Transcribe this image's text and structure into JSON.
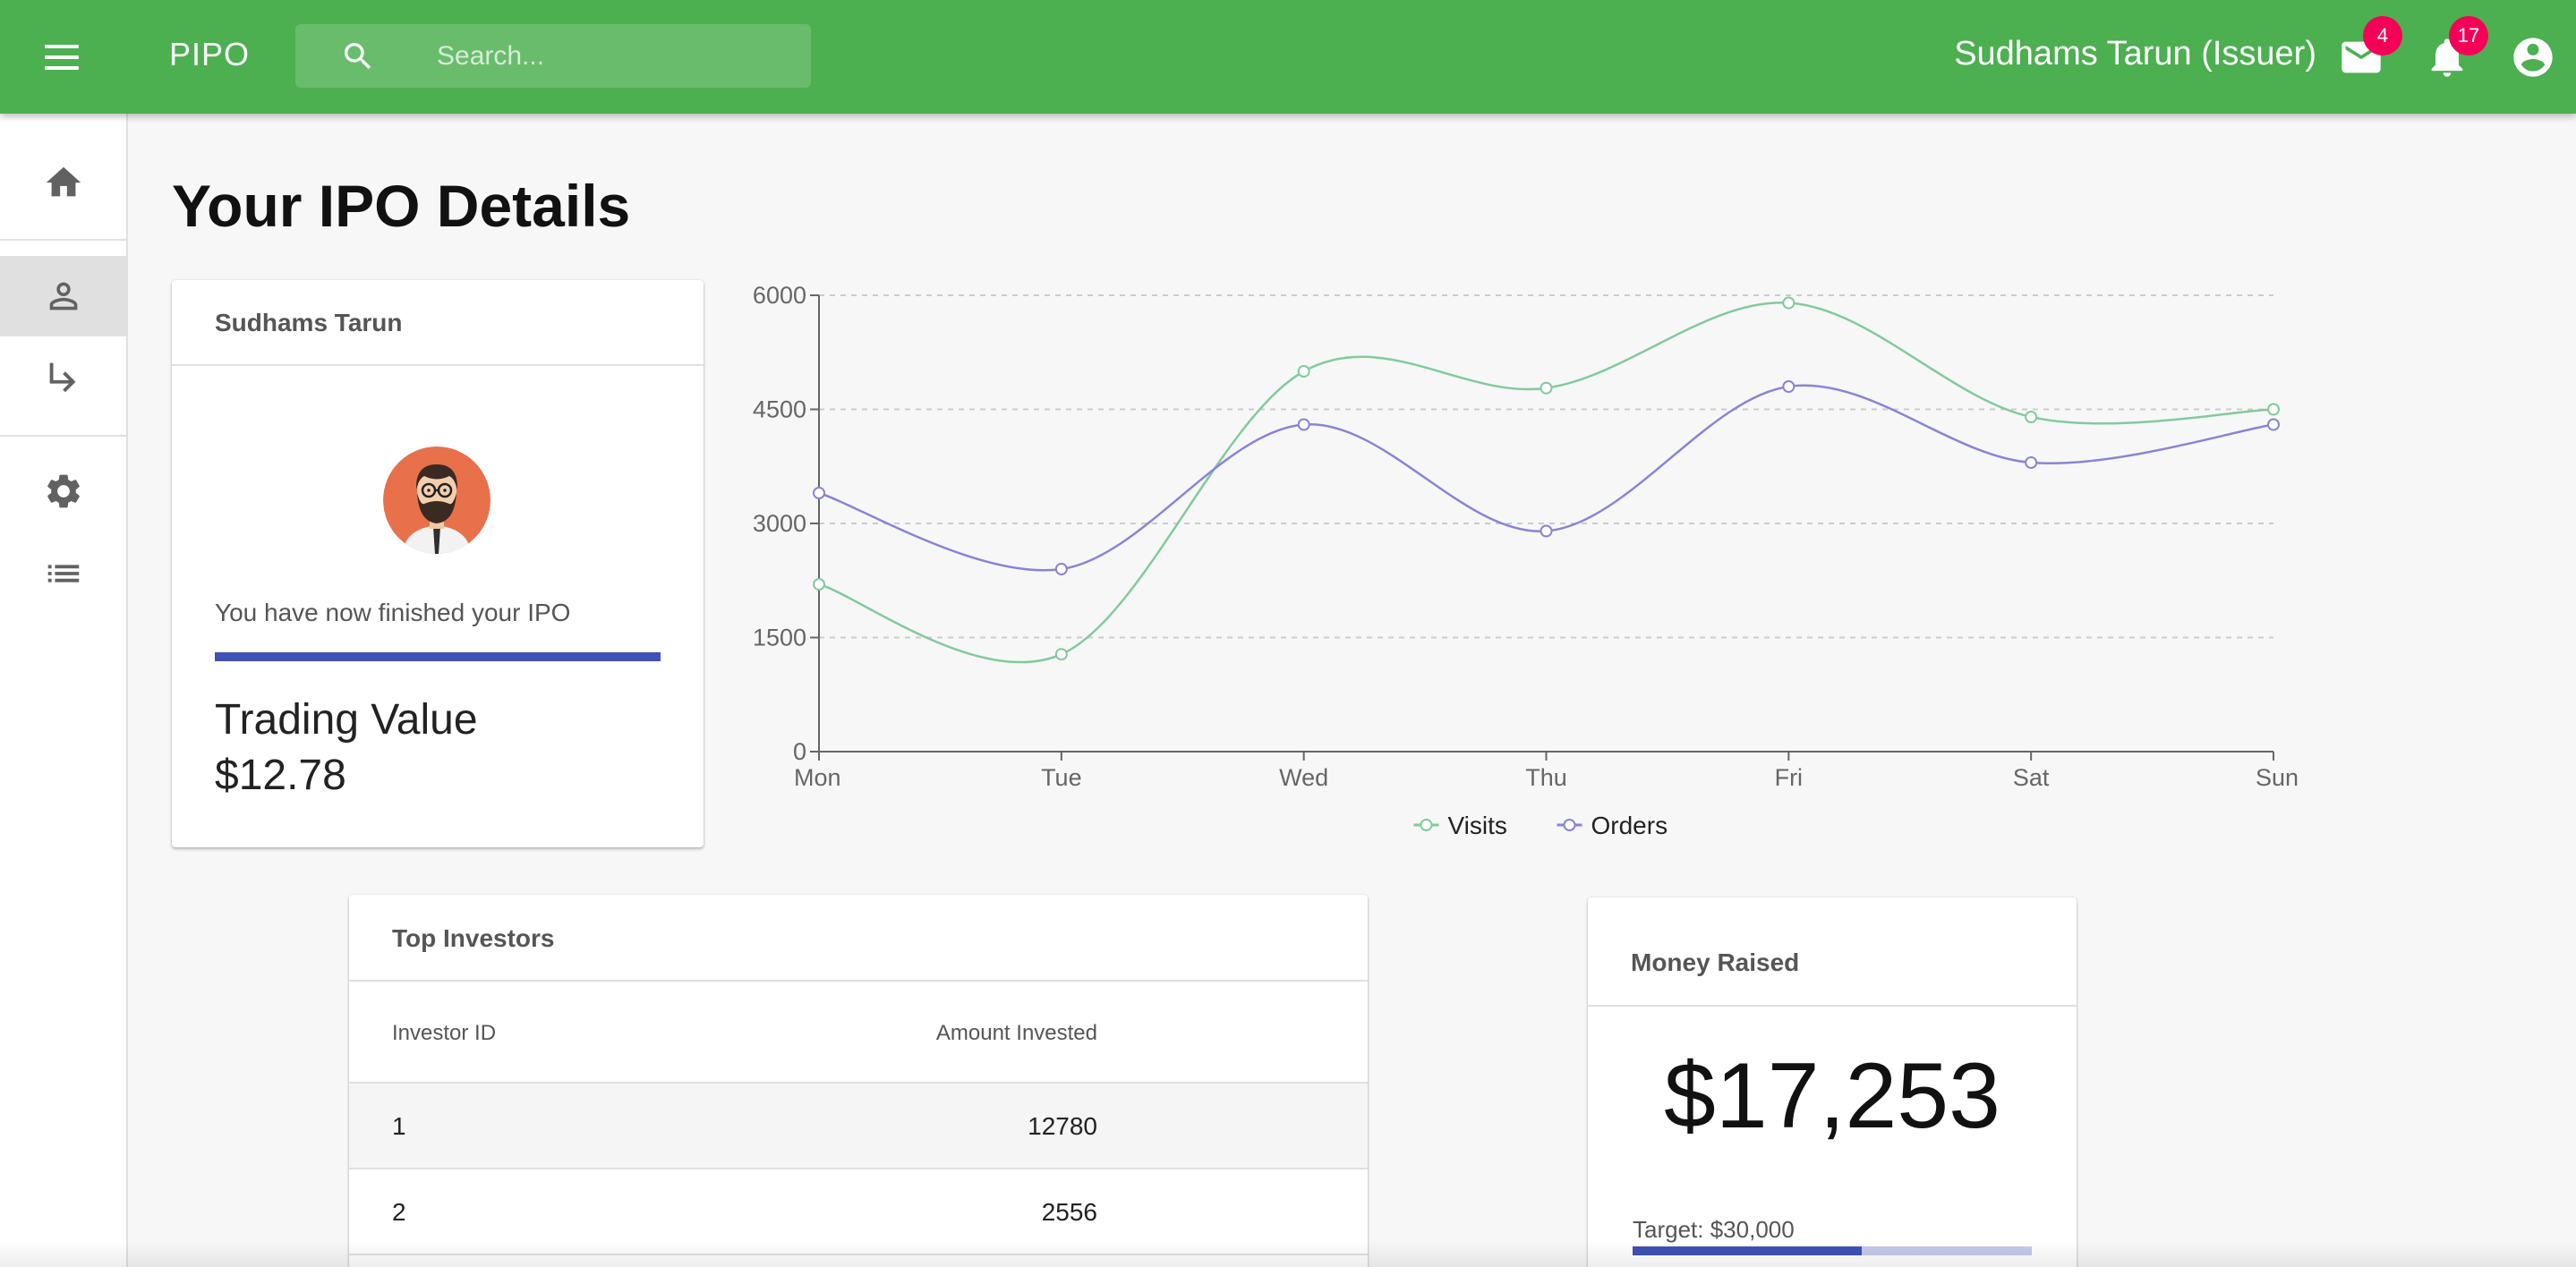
{
  "appbar": {
    "title": "PIPO",
    "search_placeholder": "Search...",
    "user_name": "Sudhams Tarun (Issuer)",
    "mail_badge": "4",
    "notification_badge": "17",
    "color": "#4caf50"
  },
  "sidebar": {
    "items": [
      {
        "icon": "home-icon",
        "active": false
      },
      {
        "icon": "person-icon",
        "active": true
      },
      {
        "icon": "subdirectory-arrow-icon",
        "active": false
      },
      {
        "icon": "settings-icon",
        "active": false
      },
      {
        "icon": "list-icon",
        "active": false
      }
    ]
  },
  "main": {
    "title": "Your IPO Details"
  },
  "profile": {
    "name": "Sudhams Tarun",
    "message": "You have now finished your IPO",
    "progress": 1.0,
    "trading_label": "Trading Value",
    "trading_value": "$12.78"
  },
  "chart_data": {
    "type": "line",
    "categories": [
      "Mon",
      "Tue",
      "Wed",
      "Thu",
      "Fri",
      "Sat",
      "Sun"
    ],
    "series": [
      {
        "name": "Visits",
        "color": "#82ca9d",
        "values": [
          2200,
          1280,
          5000,
          4780,
          5900,
          4400,
          4500
        ]
      },
      {
        "name": "Orders",
        "color": "#8884d8",
        "values": [
          3400,
          2400,
          4300,
          2900,
          4800,
          3800,
          4300
        ]
      }
    ],
    "yticks": [
      0,
      1500,
      3000,
      4500,
      6000
    ],
    "ylim": [
      0,
      6000
    ],
    "grid": true,
    "legend_position": "bottom"
  },
  "investors": {
    "title": "Top Investors",
    "columns": [
      "Investor ID",
      "Amount Invested"
    ],
    "rows": [
      {
        "id": "1",
        "amount": "12780"
      },
      {
        "id": "2",
        "amount": "2556"
      }
    ]
  },
  "money": {
    "title": "Money Raised",
    "amount": "$17,253",
    "target": "Target: $30,000",
    "progress": 0.575
  }
}
